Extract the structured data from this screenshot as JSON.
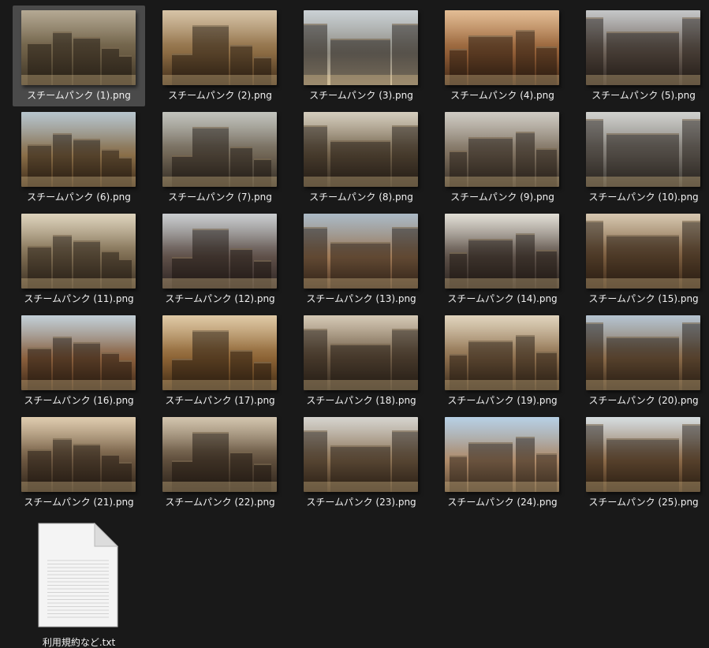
{
  "files": [
    {
      "name": "スチームパンク (1).png",
      "selected": true,
      "colors": [
        "#9b8c70",
        "#6a5c44",
        "#3b3224"
      ]
    },
    {
      "name": "スチームパンク (2).png",
      "selected": false,
      "colors": [
        "#c9b08a",
        "#8a6a42",
        "#3e2c1a"
      ]
    },
    {
      "name": "スチームパンク (3).png",
      "selected": false,
      "colors": [
        "#b9c2c7",
        "#8e8a80",
        "#c7b89b"
      ]
    },
    {
      "name": "スチームパンク (4).png",
      "selected": false,
      "colors": [
        "#d9a772",
        "#8f5c35",
        "#3d2616"
      ]
    },
    {
      "name": "スチームパンク (5).png",
      "selected": false,
      "colors": [
        "#b2b4b6",
        "#6b5f55",
        "#2e2622"
      ]
    },
    {
      "name": "スチームパンク (6).png",
      "selected": false,
      "colors": [
        "#9fb2bd",
        "#8a6e48",
        "#3b2a18"
      ]
    },
    {
      "name": "スチームパンク (7).png",
      "selected": false,
      "colors": [
        "#aeb0a8",
        "#6f6454",
        "#302a22"
      ]
    },
    {
      "name": "スチームパンク (8).png",
      "selected": false,
      "colors": [
        "#c7bda8",
        "#6e5e48",
        "#2e261e"
      ]
    },
    {
      "name": "スチームパンク (9).png",
      "selected": false,
      "colors": [
        "#bfbab0",
        "#7b6d5c",
        "#3a3128"
      ]
    },
    {
      "name": "スチームパンク (10).png",
      "selected": false,
      "colors": [
        "#c1c2be",
        "#7c7770",
        "#3a3631"
      ]
    },
    {
      "name": "スチームパンク (11).png",
      "selected": false,
      "colors": [
        "#d2c4a6",
        "#7b6a50",
        "#3a2f22"
      ]
    },
    {
      "name": "スチームパンク (12).png",
      "selected": false,
      "colors": [
        "#b8bdc0",
        "#5f5049",
        "#2b2220"
      ]
    },
    {
      "name": "スチームパンク (13).png",
      "selected": false,
      "colors": [
        "#8fa3b3",
        "#a07a56",
        "#4a3424"
      ]
    },
    {
      "name": "スチームパンク (14).png",
      "selected": false,
      "colors": [
        "#d7d3c8",
        "#5c5048",
        "#2a221d"
      ]
    },
    {
      "name": "スチームパンク (15).png",
      "selected": false,
      "colors": [
        "#c9b596",
        "#7a5c3e",
        "#3a2818"
      ]
    },
    {
      "name": "スチームパンク (16).png",
      "selected": false,
      "colors": [
        "#aebfc9",
        "#8a5f3c",
        "#3a2616"
      ]
    },
    {
      "name": "スチームパンク (17).png",
      "selected": false,
      "colors": [
        "#d5b889",
        "#8b6234",
        "#3f2a14"
      ]
    },
    {
      "name": "スチームパンク (18).png",
      "selected": false,
      "colors": [
        "#c7b79d",
        "#6d5a45",
        "#2f261d"
      ]
    },
    {
      "name": "スチームパンク (19).png",
      "selected": false,
      "colors": [
        "#d6c6a8",
        "#8b6d4c",
        "#3b2c1c"
      ]
    },
    {
      "name": "スチームパンク (20).png",
      "selected": false,
      "colors": [
        "#9db1c2",
        "#8a6a48",
        "#3a2b1c"
      ]
    },
    {
      "name": "スチームパンク (21).png",
      "selected": false,
      "colors": [
        "#d4bb95",
        "#6b5640",
        "#2d2218"
      ]
    },
    {
      "name": "スチームパンク (22).png",
      "selected": false,
      "colors": [
        "#c4b294",
        "#5f4e3c",
        "#2a2119"
      ]
    },
    {
      "name": "スチームパンク (23).png",
      "selected": false,
      "colors": [
        "#c8c6bf",
        "#8c7254",
        "#3b2c1d"
      ]
    },
    {
      "name": "スチームパンク (24).png",
      "selected": false,
      "colors": [
        "#9fc0dc",
        "#b08c6a",
        "#5a4632"
      ]
    },
    {
      "name": "スチームパンク (25).png",
      "selected": false,
      "colors": [
        "#c9d2d6",
        "#8c6a48",
        "#3e2c1a"
      ]
    }
  ],
  "txt_file": {
    "name": "利用規約など.txt"
  },
  "icons": {
    "text_document": "text-document-icon"
  }
}
